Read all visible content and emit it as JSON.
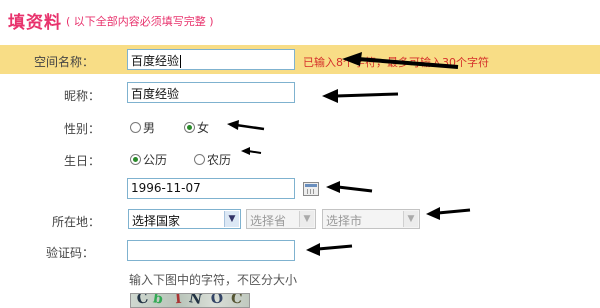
{
  "header": {
    "title": "填资料",
    "note": "( 以下全部内容必须填写完整 )"
  },
  "form": {
    "space_name": {
      "label": "空间名称：",
      "value": "百度经验",
      "hint": "已输入8个字符，最多可输入30个字符"
    },
    "nickname": {
      "label": "昵称：",
      "value": "百度经验"
    },
    "gender": {
      "label": "性别：",
      "options": [
        "男",
        "女"
      ],
      "selected": "女"
    },
    "birthday": {
      "label": "生日：",
      "calendar_options": [
        "公历",
        "农历"
      ],
      "selected": "公历",
      "date": "1996-11-07"
    },
    "location": {
      "label": "所在地：",
      "country": "选择国家",
      "province": "选择省",
      "city": "选择市"
    },
    "captcha": {
      "label": "验证码：",
      "value": "",
      "hint": "输入下图中的字符，不区分大小"
    }
  },
  "icons": [
    "calendar-icon",
    "dropdown-arrow-icon",
    "radio-icon",
    "annotation-arrow-icon"
  ]
}
